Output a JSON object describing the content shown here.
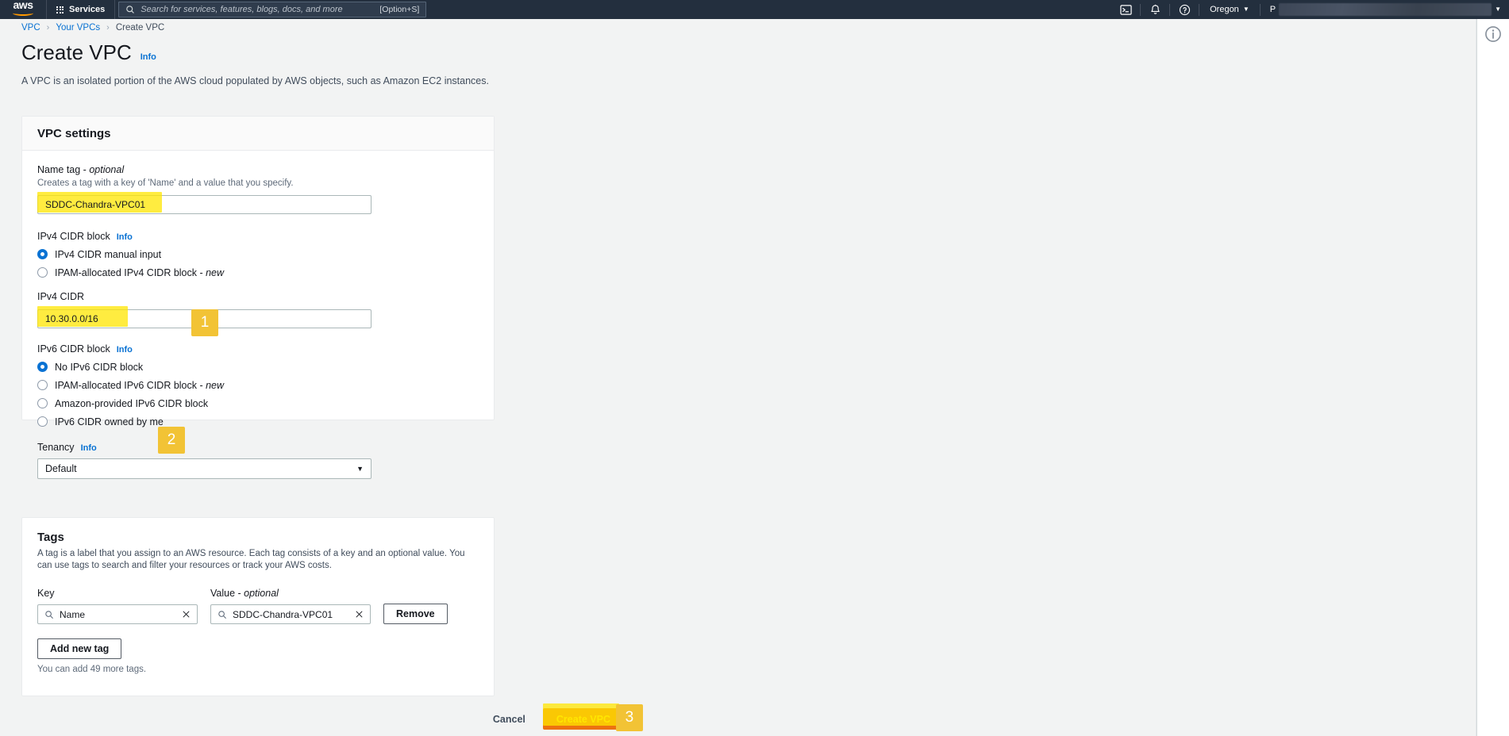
{
  "topnav": {
    "logo_text": "aws",
    "services_label": "Services",
    "search_placeholder": "Search for services, features, blogs, docs, and more",
    "search_shortcut": "[Option+S]",
    "cloudshell_icon": "cloudshell-icon",
    "notifications_icon": "bell-icon",
    "help_icon": "question-circle-icon",
    "region_label": "Oregon",
    "region_caret": "▼",
    "account_label": "P",
    "account_caret": "▼"
  },
  "breadcrumb": {
    "items": [
      {
        "label": "VPC",
        "link": true
      },
      {
        "label": "Your VPCs",
        "link": true
      },
      {
        "label": "Create VPC",
        "link": false
      }
    ],
    "separator": "›"
  },
  "page": {
    "title": "Create VPC",
    "info_label": "Info",
    "description": "A VPC is an isolated portion of the AWS cloud populated by AWS objects, such as Amazon EC2 instances."
  },
  "vpc_settings": {
    "card_title": "VPC settings",
    "name_tag": {
      "label": "Name tag - ",
      "label_optional": "optional",
      "description": "Creates a tag with a key of 'Name' and a value that you specify.",
      "value": "SDDC-Chandra-VPC01",
      "badge": "1"
    },
    "ipv4_cidr_block": {
      "label": "IPv4 CIDR block",
      "info_label": "Info",
      "options": [
        {
          "label": "IPv4 CIDR manual input",
          "selected": true
        },
        {
          "label": "IPAM-allocated IPv4 CIDR block - ",
          "label_em": "new",
          "selected": false
        }
      ]
    },
    "ipv4_cidr": {
      "label": "IPv4 CIDR",
      "value": "10.30.0.0/16",
      "badge": "2"
    },
    "ipv6_cidr_block": {
      "label": "IPv6 CIDR block",
      "info_label": "Info",
      "options": [
        {
          "label": "No IPv6 CIDR block",
          "selected": true
        },
        {
          "label": "IPAM-allocated IPv6 CIDR block - ",
          "label_em": "new",
          "selected": false
        },
        {
          "label": "Amazon-provided IPv6 CIDR block",
          "selected": false
        },
        {
          "label": "IPv6 CIDR owned by me",
          "selected": false
        }
      ]
    },
    "tenancy": {
      "label": "Tenancy",
      "info_label": "Info",
      "value": "Default",
      "caret": "▼"
    }
  },
  "tags": {
    "card_title": "Tags",
    "description": "A tag is a label that you assign to an AWS resource. Each tag consists of a key and an optional value. You can use tags to search and filter your resources or track your AWS costs.",
    "key_label": "Key",
    "value_label": "Value - ",
    "value_label_optional": "optional",
    "rows": [
      {
        "key": "Name",
        "value": "SDDC-Chandra-VPC01",
        "remove_label": "Remove"
      }
    ],
    "add_tag_label": "Add new tag",
    "note": "You can add 49 more tags.",
    "search_icon": "search-icon",
    "clear_icon": "close-x-icon"
  },
  "footer": {
    "cancel_label": "Cancel",
    "create_label": "Create VPC",
    "create_badge": "3"
  },
  "right_panel": {
    "info_icon": "info-circle-icon"
  },
  "colors": {
    "nav_background": "#232f3e",
    "accent_orange": "#ec7211",
    "link_blue": "#0972d3",
    "highlight_yellow": "#ffe600",
    "badge_amber": "#f2c335",
    "page_background": "#f2f3f3"
  }
}
